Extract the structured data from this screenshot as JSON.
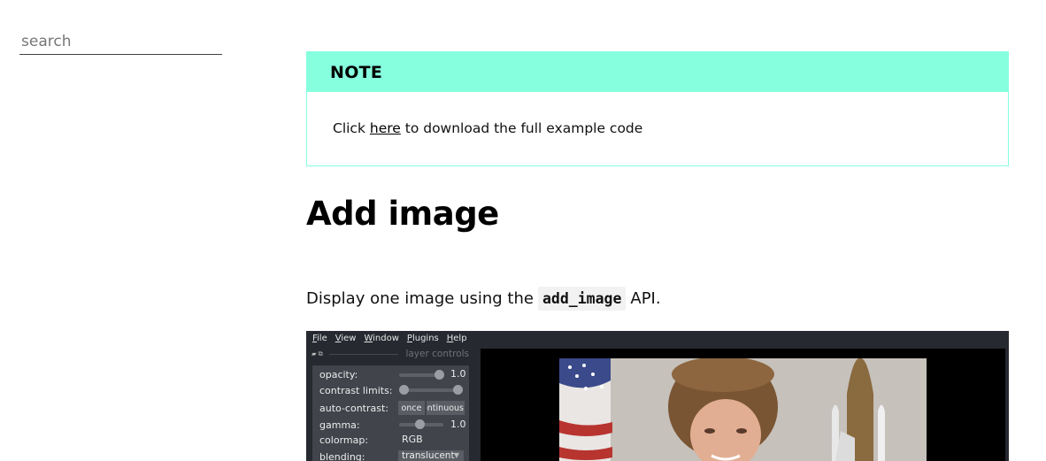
{
  "sidebar": {
    "search_placeholder": "search"
  },
  "note": {
    "title": "NOTE",
    "text_before": "Click ",
    "link": "here",
    "text_after": " to download the full example code"
  },
  "heading": "Add image",
  "paragraph": {
    "before": "Display one image using the",
    "code": "add_image",
    "after": "API."
  },
  "napari": {
    "menu": [
      "File",
      "View",
      "Window",
      "Plugins",
      "Help"
    ],
    "panel_title": "layer controls",
    "controls": {
      "opacity_label": "opacity:",
      "opacity_value": "1.0",
      "contrast_label": "contrast limits:",
      "auto_contrast_label": "auto-contrast:",
      "once_button": "once",
      "continuous_button": "continuous",
      "gamma_label": "gamma:",
      "gamma_value": "1.0",
      "colormap_label": "colormap:",
      "colormap_value": "RGB",
      "blending_label": "blending:",
      "blending_value": "translucent"
    }
  },
  "colors": {
    "note_accent": "#86ffdf",
    "napari_bg": "#262930"
  }
}
